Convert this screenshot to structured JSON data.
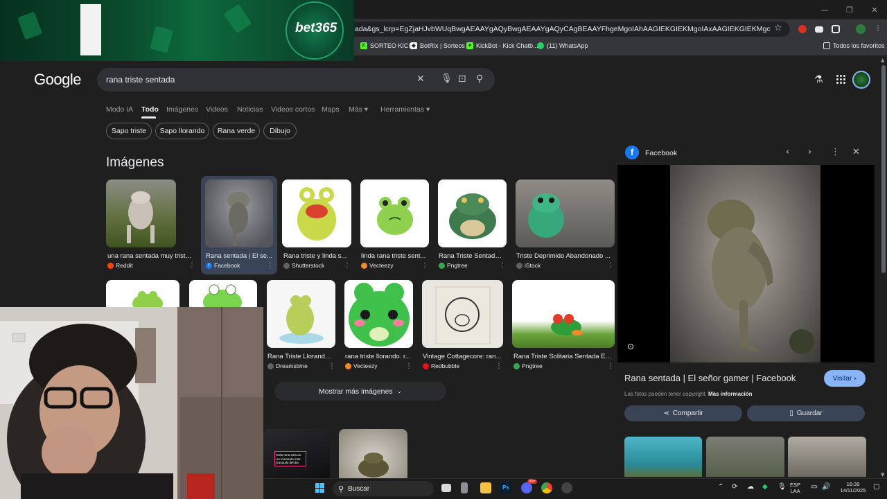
{
  "browser": {
    "url": "ada&gs_lcrp=EgZjaHJvbWUqBwgAEAAYgAQyBwgAEAAYgAQyCAgBEAAYFhgeMgoIAhAAGIEKGIEKMgoIAxAAGIEKGIEKMgcIBBAAGO8F0gEIMTg...",
    "window_controls": [
      "—",
      "❐",
      "✕"
    ],
    "bookmarks": [
      {
        "label": "SORTEO KICK",
        "icon": "kick-icon",
        "color": "#53fc18"
      },
      {
        "label": "BotRix | Sorteos",
        "icon": "botrix-icon",
        "color": "#ffffff"
      },
      {
        "label": "KickBot - Kick Chatb...",
        "icon": "kickbot-icon",
        "color": "#53fc18"
      },
      {
        "label": "(11) WhatsApp",
        "icon": "whatsapp-icon",
        "color": "#25d366"
      }
    ],
    "all_bookmarks": "Todos los favoritos"
  },
  "overlay_banner": {
    "brand": "bet365"
  },
  "google": {
    "logo": "Google",
    "query": "rana triste sentada",
    "nav_tabs": [
      "Modo IA",
      "Todo",
      "Imágenes",
      "Videos",
      "Noticias",
      "Videos cortos",
      "Maps",
      "Más ▾",
      "Herramientas ▾"
    ],
    "active_tab": "Todo",
    "chips": [
      "Sapo triste",
      "Sapo llorando",
      "Rana verde",
      "Dibujo"
    ],
    "section_title": "Imágenes",
    "images_row1": [
      {
        "caption": "una rana sentada muy triste...",
        "source": "Reddit",
        "src_color": "#ff4500",
        "thumb": "#6f7a55"
      },
      {
        "caption": "Rana sentada | El se...",
        "source": "Facebook",
        "src_color": "#1877f2",
        "thumb": "#5d5d62",
        "selected": true
      },
      {
        "caption": "Rana triste y linda s...",
        "source": "Shutterstock",
        "src_color": "#9aa0a6",
        "thumb": "#f3f3f3"
      },
      {
        "caption": "linda rana triste sent...",
        "source": "Vecteezy",
        "src_color": "#f28b25",
        "thumb": "#ffffff"
      },
      {
        "caption": "Rana Triste Sentada...",
        "source": "Pngtree",
        "src_color": "#34a853",
        "thumb": "#ffffff"
      },
      {
        "caption": "Triste Deprimido Abandonado ...",
        "source": "iStock",
        "src_color": "#9aa0a6",
        "thumb": "#6c6b67"
      }
    ],
    "images_row2": [
      {
        "caption": "Rana Triste Llorando...",
        "source": "Dreamstime",
        "src_color": "#9aa0a6",
        "thumb": "#f6f6f6"
      },
      {
        "caption": "rana triste llorando. r...",
        "source": "Vecteezy",
        "src_color": "#f28b25",
        "thumb": "#ffffff"
      },
      {
        "caption": "Vintage Cottagecore: ran...",
        "source": "Redbubble",
        "src_color": "#e41321",
        "thumb": "#e9e6df"
      },
      {
        "caption": "Rana Triste Solitaria Sentada En...",
        "source": "Pngtree",
        "src_color": "#34a853",
        "thumb": "#f5f7f5"
      }
    ],
    "more_images": "Mostrar más imágenes",
    "video_thumb_text": "Esta rana esta en su momento mas tranquilo del dia"
  },
  "panel": {
    "source": "Facebook",
    "title": "Rana sentada | El señor gamer | Facebook",
    "visit": "Visitar",
    "copyright": "Las fotos pueden tener copyright.",
    "more_info": "Más información",
    "share": "Compartir",
    "save": "Guardar"
  },
  "taskbar": {
    "search": "Buscar",
    "lang_top": "ESP",
    "lang_bottom": "LAA",
    "time": "16:39",
    "date": "14/11/2025",
    "badge": "99+"
  }
}
